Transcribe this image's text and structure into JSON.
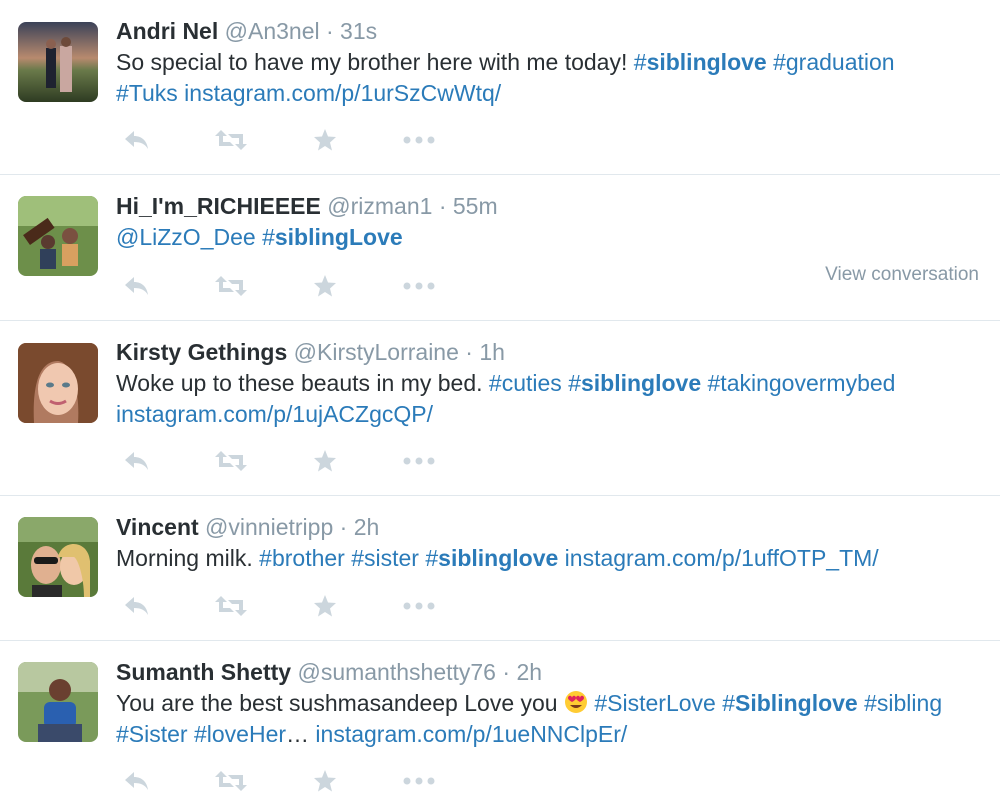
{
  "tweets": [
    {
      "name": "Andri Nel",
      "handle": "@An3nel",
      "time": "31s",
      "parts": [
        "So special to have my brother here with me today! ",
        "#",
        "siblinglove",
        " #graduation",
        "#Tuks",
        " instagram.com/p/1urSzCwWtq/"
      ]
    },
    {
      "name": "Hi_I'm_RICHIEEEE",
      "handle": "@rizman1",
      "time": "55m",
      "parts": [
        "@LiZzO_Dee",
        " ",
        "#",
        "siblingLove"
      ],
      "view_conversation": "View conversation"
    },
    {
      "name": "Kirsty Gethings",
      "handle": "@KirstyLorraine",
      "time": "1h",
      "parts": [
        "Woke up to these beauts in my bed. ",
        "#cuties",
        " ",
        "#",
        "siblinglove",
        " #takingovermybed",
        "instagram.com/p/1ujACZgcQP/"
      ]
    },
    {
      "name": "Vincent",
      "handle": "@vinnietripp",
      "time": "2h",
      "parts": [
        "Morning milk. ",
        "#brother",
        " #sister",
        " ",
        "#",
        "siblinglove",
        " instagram.com/p/1uffOTP_TM/"
      ]
    },
    {
      "name": "Sumanth Shetty",
      "handle": "@sumanthshetty76",
      "time": "2h",
      "parts": [
        "You are the best sushmasandeep Love you ",
        " #SisterLove",
        " ",
        "#",
        "Siblinglove",
        " #sibling",
        "#Sister",
        " #loveHer",
        "…",
        " instagram.com/p/1ueNNClpEr/"
      ]
    }
  ],
  "dot": "·",
  "icons": [
    "reply-icon",
    "retweet-icon",
    "favorite-star-icon",
    "more-dots-icon",
    "heart-eyes-emoji"
  ]
}
